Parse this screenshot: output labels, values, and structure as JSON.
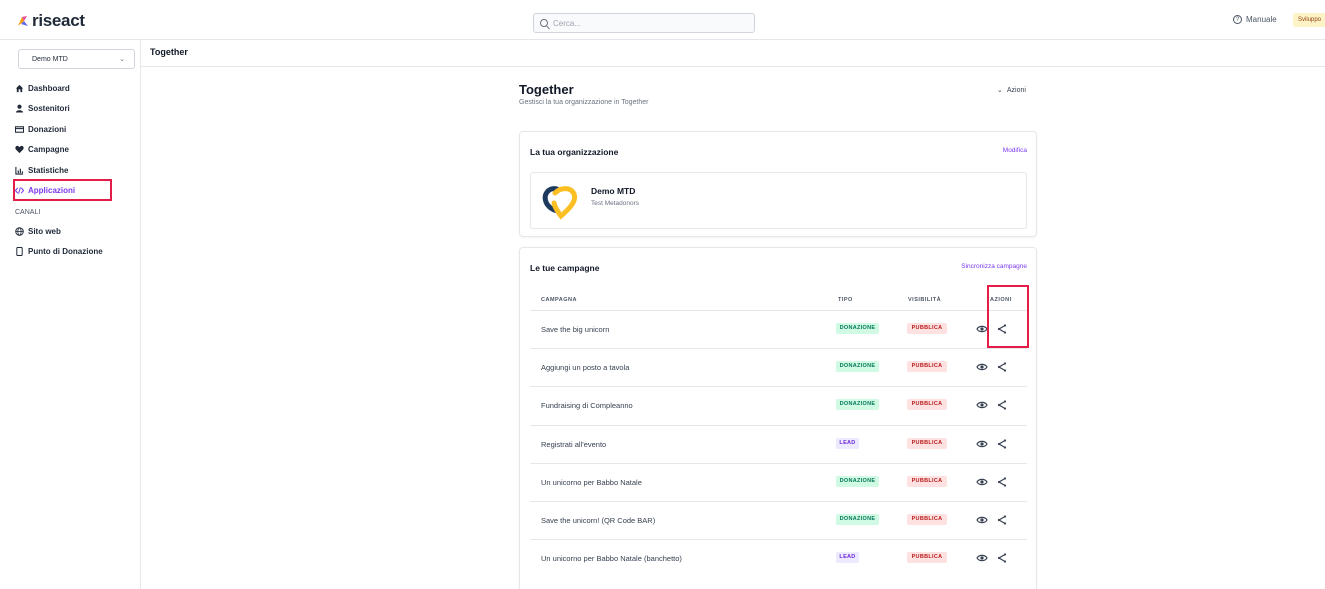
{
  "app": {
    "name": "riseact"
  },
  "topbar": {
    "search_placeholder": "Cerca...",
    "manual_label": "Manuale",
    "dev_badge": "Sviluppo"
  },
  "sidebar": {
    "org_selector": "Demo MTD",
    "items": [
      {
        "label": "Dashboard",
        "icon": "home-icon"
      },
      {
        "label": "Sostenitori",
        "icon": "user-icon"
      },
      {
        "label": "Donazioni",
        "icon": "money-icon"
      },
      {
        "label": "Campagne",
        "icon": "heart-icon"
      },
      {
        "label": "Statistiche",
        "icon": "chart-icon"
      },
      {
        "label": "Applicazioni",
        "icon": "code-icon",
        "active": true
      }
    ],
    "section_label": "CANALI",
    "channels": [
      {
        "label": "Sito web",
        "icon": "globe-icon"
      },
      {
        "label": "Punto di Donazione",
        "icon": "phone-icon"
      }
    ]
  },
  "breadcrumb": "Together",
  "page": {
    "title": "Together",
    "subtitle": "Gestisci la tua organizzazione in Together",
    "actions_label": "Azioni"
  },
  "org_card": {
    "title": "La tua organizzazione",
    "edit_link": "Modifica",
    "org_name": "Demo MTD",
    "org_desc": "Test Metadonors"
  },
  "campaigns_card": {
    "title": "Le tue campagne",
    "sync_link": "Sincronizza campagne",
    "headers": {
      "campaign": "CAMPAGNA",
      "type": "TIPO",
      "visibility": "VISIBILITÀ",
      "actions": "AZIONI"
    },
    "rows": [
      {
        "name": "Save the big unicorn",
        "type": "DONAZIONE",
        "visibility": "PUBBLICA"
      },
      {
        "name": "Aggiungi un posto a tavola",
        "type": "DONAZIONE",
        "visibility": "PUBBLICA"
      },
      {
        "name": "Fundraising di Compleanno",
        "type": "DONAZIONE",
        "visibility": "PUBBLICA"
      },
      {
        "name": "Registrati all'evento",
        "type": "LEAD",
        "visibility": "PUBBLICA"
      },
      {
        "name": "Un unicorno per Babbo Natale",
        "type": "DONAZIONE",
        "visibility": "PUBBLICA"
      },
      {
        "name": "Save the unicorn! (QR Code BAR)",
        "type": "DONAZIONE",
        "visibility": "PUBBLICA"
      },
      {
        "name": "Un unicorno per Babbo Natale (banchetto)",
        "type": "LEAD",
        "visibility": "PUBBLICA"
      }
    ]
  },
  "colors": {
    "accent": "#7c3aed",
    "highlight": "#e11d48",
    "badge_green": "#d1fae5",
    "badge_red": "#fee2e2",
    "badge_purple": "#ede9fe"
  }
}
